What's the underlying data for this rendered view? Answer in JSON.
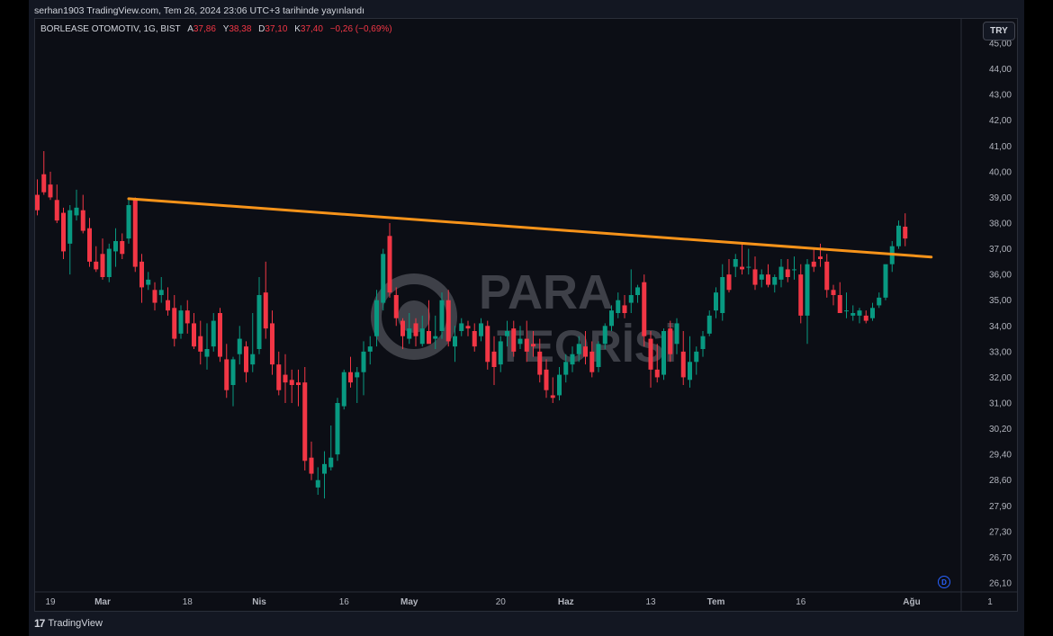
{
  "header": {
    "publication": "serhan1903 TradingView.com, Tem 26, 2024 23:06 UTC+3 tarihinde yayınlandı"
  },
  "legend": {
    "symbol": "BORLEASE OTOMOTIV, 1G, BIST",
    "open_label": "A",
    "open": "37,86",
    "high_label": "Y",
    "high": "38,38",
    "low_label": "D",
    "low": "37,10",
    "close_label": "K",
    "close": "37,40",
    "change": "−0,26 (−0,69%)"
  },
  "currency_button": "TRY",
  "watermark": {
    "line1": "PARA",
    "line2": "TEORİSİ"
  },
  "footer": {
    "brand": "TradingView",
    "logo_glyph": "17"
  },
  "dividend_badge": "D",
  "colors": {
    "up": "#089981",
    "down": "#f23645",
    "trendline": "#f7931a",
    "background": "#0c0e15",
    "axis_text": "#b2b5be"
  },
  "chart_data": {
    "type": "candlestick",
    "title": "BORLEASE OTOMOTIV, 1G, BIST",
    "y_ticks": [
      {
        "label": "45,00",
        "value": 45.0
      },
      {
        "label": "44,00",
        "value": 44.0
      },
      {
        "label": "43,00",
        "value": 43.0
      },
      {
        "label": "42,00",
        "value": 42.0
      },
      {
        "label": "41,00",
        "value": 41.0
      },
      {
        "label": "40,00",
        "value": 40.0
      },
      {
        "label": "39,00",
        "value": 39.0
      },
      {
        "label": "38,00",
        "value": 38.0
      },
      {
        "label": "37,00",
        "value": 37.0
      },
      {
        "label": "36,00",
        "value": 36.0
      },
      {
        "label": "35,00",
        "value": 35.0
      },
      {
        "label": "34,00",
        "value": 34.0
      },
      {
        "label": "33,00",
        "value": 33.0
      },
      {
        "label": "32,00",
        "value": 32.0
      },
      {
        "label": "31,00",
        "value": 31.0
      },
      {
        "label": "30,20",
        "value": 30.2
      },
      {
        "label": "29,40",
        "value": 29.4
      },
      {
        "label": "28,60",
        "value": 28.6
      },
      {
        "label": "27,90",
        "value": 27.9
      },
      {
        "label": "27,30",
        "value": 27.3
      },
      {
        "label": "26,70",
        "value": 26.7
      },
      {
        "label": "26,10",
        "value": 26.1
      }
    ],
    "y_scale": "log",
    "x_ticks": [
      "19",
      "Mar",
      "18",
      "Nis",
      "16",
      "May",
      "20",
      "Haz",
      "13",
      "Tem",
      "16",
      "Ağu",
      "1"
    ],
    "x_tick_bold": [
      false,
      true,
      false,
      true,
      false,
      true,
      false,
      true,
      false,
      true,
      false,
      true,
      false
    ],
    "x_tick_index": [
      2,
      10,
      23,
      34,
      47,
      57,
      71,
      81,
      94,
      104,
      117,
      134,
      146
    ],
    "candles": [
      [
        39.1,
        39.7,
        38.3,
        38.5
      ],
      [
        39.9,
        40.8,
        39.1,
        39.2
      ],
      [
        39.5,
        40.0,
        38.9,
        39.0
      ],
      [
        38.9,
        39.5,
        38.0,
        38.1
      ],
      [
        38.4,
        38.6,
        36.6,
        36.9
      ],
      [
        37.2,
        38.7,
        36.0,
        38.5
      ],
      [
        38.3,
        39.3,
        38.1,
        38.6
      ],
      [
        38.5,
        39.1,
        37.6,
        37.7
      ],
      [
        37.8,
        38.2,
        36.3,
        36.5
      ],
      [
        36.5,
        37.1,
        36.1,
        36.2
      ],
      [
        36.8,
        37.4,
        35.8,
        35.9
      ],
      [
        35.9,
        37.2,
        35.7,
        37.0
      ],
      [
        36.9,
        37.8,
        36.3,
        37.3
      ],
      [
        37.3,
        37.6,
        36.6,
        36.8
      ],
      [
        37.4,
        38.9,
        37.2,
        38.7
      ],
      [
        38.9,
        39.0,
        36.1,
        36.3
      ],
      [
        36.5,
        36.8,
        34.9,
        35.5
      ],
      [
        35.6,
        36.1,
        35.4,
        35.8
      ],
      [
        35.4,
        35.7,
        34.6,
        34.9
      ],
      [
        35.2,
        35.9,
        34.9,
        35.4
      ],
      [
        35.0,
        35.5,
        34.4,
        34.6
      ],
      [
        34.7,
        35.2,
        33.2,
        33.5
      ],
      [
        33.7,
        34.8,
        33.5,
        34.6
      ],
      [
        34.6,
        35.0,
        33.7,
        34.1
      ],
      [
        34.1,
        34.5,
        33.1,
        33.2
      ],
      [
        33.6,
        34.2,
        32.5,
        33.0
      ],
      [
        32.8,
        34.1,
        32.3,
        33.1
      ],
      [
        33.2,
        34.5,
        33.0,
        34.2
      ],
      [
        34.5,
        34.7,
        32.6,
        32.8
      ],
      [
        32.7,
        33.3,
        31.2,
        31.5
      ],
      [
        31.7,
        32.8,
        30.9,
        32.7
      ],
      [
        32.9,
        34.0,
        32.5,
        33.5
      ],
      [
        33.2,
        33.4,
        31.8,
        32.2
      ],
      [
        32.5,
        34.5,
        32.2,
        32.9
      ],
      [
        33.1,
        35.9,
        32.9,
        35.2
      ],
      [
        35.3,
        36.5,
        33.5,
        33.9
      ],
      [
        34.1,
        34.6,
        32.1,
        32.5
      ],
      [
        32.5,
        33.0,
        31.3,
        31.5
      ],
      [
        32.1,
        32.9,
        31.0,
        31.8
      ],
      [
        31.9,
        32.3,
        31.0,
        31.7
      ],
      [
        31.8,
        32.3,
        30.9,
        31.7
      ],
      [
        31.8,
        32.4,
        28.9,
        29.2
      ],
      [
        29.3,
        29.8,
        28.6,
        28.8
      ],
      [
        28.4,
        29.0,
        28.2,
        28.6
      ],
      [
        28.8,
        29.5,
        28.1,
        29.1
      ],
      [
        29.0,
        30.3,
        28.9,
        29.3
      ],
      [
        29.4,
        31.2,
        29.2,
        31.0
      ],
      [
        30.9,
        32.3,
        30.8,
        32.2
      ],
      [
        32.2,
        32.8,
        31.6,
        31.8
      ],
      [
        32.0,
        32.4,
        31.0,
        32.2
      ],
      [
        32.2,
        33.4,
        31.3,
        33.0
      ],
      [
        33.0,
        33.6,
        32.5,
        33.2
      ],
      [
        33.6,
        35.4,
        33.2,
        35.0
      ],
      [
        34.9,
        37.0,
        34.6,
        36.8
      ],
      [
        37.5,
        38.0,
        35.1,
        35.3
      ],
      [
        35.2,
        35.5,
        34.0,
        34.3
      ],
      [
        34.2,
        34.3,
        33.1,
        33.6
      ],
      [
        33.5,
        34.5,
        33.3,
        33.9
      ],
      [
        34.1,
        34.3,
        33.2,
        33.6
      ],
      [
        33.3,
        34.4,
        33.2,
        33.9
      ],
      [
        33.8,
        35.0,
        33.3,
        33.3
      ],
      [
        33.5,
        34.4,
        33.1,
        33.6
      ],
      [
        33.8,
        35.3,
        33.5,
        35.0
      ],
      [
        35.0,
        35.4,
        33.2,
        33.4
      ],
      [
        33.2,
        34.0,
        32.6,
        33.6
      ],
      [
        33.8,
        34.3,
        33.6,
        34.1
      ],
      [
        34.0,
        34.2,
        33.6,
        33.9
      ],
      [
        33.8,
        34.1,
        33.0,
        33.2
      ],
      [
        33.6,
        34.3,
        33.4,
        34.1
      ],
      [
        34.0,
        34.2,
        32.3,
        32.6
      ],
      [
        33.0,
        33.6,
        31.7,
        32.4
      ],
      [
        32.5,
        33.6,
        32.2,
        33.4
      ],
      [
        33.6,
        34.2,
        33.2,
        33.8
      ],
      [
        33.9,
        34.2,
        32.8,
        33.0
      ],
      [
        33.3,
        34.0,
        33.1,
        33.5
      ],
      [
        33.5,
        34.2,
        32.6,
        33.0
      ],
      [
        33.3,
        33.8,
        32.8,
        33.2
      ],
      [
        33.0,
        33.5,
        31.8,
        32.1
      ],
      [
        32.3,
        32.7,
        31.2,
        31.5
      ],
      [
        31.3,
        32.0,
        31.0,
        31.2
      ],
      [
        31.3,
        32.4,
        31.1,
        32.1
      ],
      [
        32.1,
        32.9,
        31.8,
        32.6
      ],
      [
        32.5,
        33.2,
        32.2,
        32.9
      ],
      [
        32.9,
        33.6,
        32.6,
        33.3
      ],
      [
        33.2,
        33.8,
        32.5,
        32.8
      ],
      [
        33.0,
        33.4,
        32.0,
        32.2
      ],
      [
        32.4,
        33.4,
        32.2,
        33.3
      ],
      [
        33.3,
        34.1,
        33.1,
        34.0
      ],
      [
        34.0,
        34.8,
        33.8,
        34.6
      ],
      [
        34.5,
        35.3,
        34.3,
        35.0
      ],
      [
        34.8,
        35.2,
        34.3,
        34.5
      ],
      [
        34.9,
        36.2,
        34.5,
        35.2
      ],
      [
        35.2,
        35.6,
        34.9,
        35.5
      ],
      [
        35.7,
        36.0,
        33.2,
        33.6
      ],
      [
        33.5,
        33.8,
        31.6,
        32.3
      ],
      [
        32.3,
        33.3,
        31.8,
        32.0
      ],
      [
        32.1,
        33.9,
        31.9,
        33.8
      ],
      [
        33.9,
        34.2,
        32.6,
        32.9
      ],
      [
        33.3,
        34.3,
        32.9,
        34.1
      ],
      [
        33.0,
        33.8,
        31.7,
        32.0
      ],
      [
        31.9,
        33.6,
        31.6,
        32.6
      ],
      [
        32.6,
        33.2,
        32.1,
        33.0
      ],
      [
        33.1,
        33.8,
        32.8,
        33.6
      ],
      [
        33.7,
        34.6,
        33.6,
        34.4
      ],
      [
        34.6,
        35.5,
        34.3,
        35.3
      ],
      [
        34.5,
        36.4,
        34.2,
        35.9
      ],
      [
        36.0,
        36.6,
        35.3,
        35.4
      ],
      [
        36.3,
        36.8,
        35.9,
        36.6
      ],
      [
        36.3,
        37.2,
        36.0,
        36.2
      ],
      [
        36.3,
        37.0,
        36.0,
        36.3
      ],
      [
        36.2,
        36.7,
        35.4,
        35.6
      ],
      [
        35.8,
        36.2,
        35.5,
        36.0
      ],
      [
        36.0,
        36.4,
        35.5,
        35.6
      ],
      [
        35.6,
        36.0,
        35.3,
        35.9
      ],
      [
        35.8,
        36.6,
        35.5,
        36.3
      ],
      [
        36.2,
        36.6,
        35.7,
        35.9
      ],
      [
        36.2,
        36.7,
        35.8,
        36.2
      ],
      [
        36.0,
        36.4,
        34.1,
        34.4
      ],
      [
        34.4,
        36.6,
        33.3,
        36.4
      ],
      [
        36.5,
        37.0,
        36.1,
        36.3
      ],
      [
        36.7,
        37.2,
        36.3,
        36.6
      ],
      [
        36.5,
        36.8,
        35.1,
        35.4
      ],
      [
        35.4,
        35.6,
        34.8,
        35.2
      ],
      [
        35.2,
        35.7,
        34.5,
        34.5
      ],
      [
        34.6,
        35.3,
        34.3,
        34.6
      ],
      [
        34.4,
        34.8,
        34.2,
        34.5
      ],
      [
        34.4,
        34.7,
        34.1,
        34.6
      ],
      [
        34.4,
        34.6,
        34.1,
        34.2
      ],
      [
        34.3,
        34.9,
        34.2,
        34.7
      ],
      [
        34.8,
        35.3,
        34.7,
        35.1
      ],
      [
        35.1,
        36.0,
        35.0,
        36.4
      ],
      [
        36.4,
        37.3,
        36.1,
        37.1
      ],
      [
        37.1,
        38.1,
        37.0,
        37.9
      ],
      [
        37.86,
        38.38,
        37.1,
        37.4
      ]
    ],
    "trendline": {
      "start": {
        "index": 14,
        "value": 38.95
      },
      "end": {
        "index": 137,
        "value": 36.68
      }
    }
  }
}
